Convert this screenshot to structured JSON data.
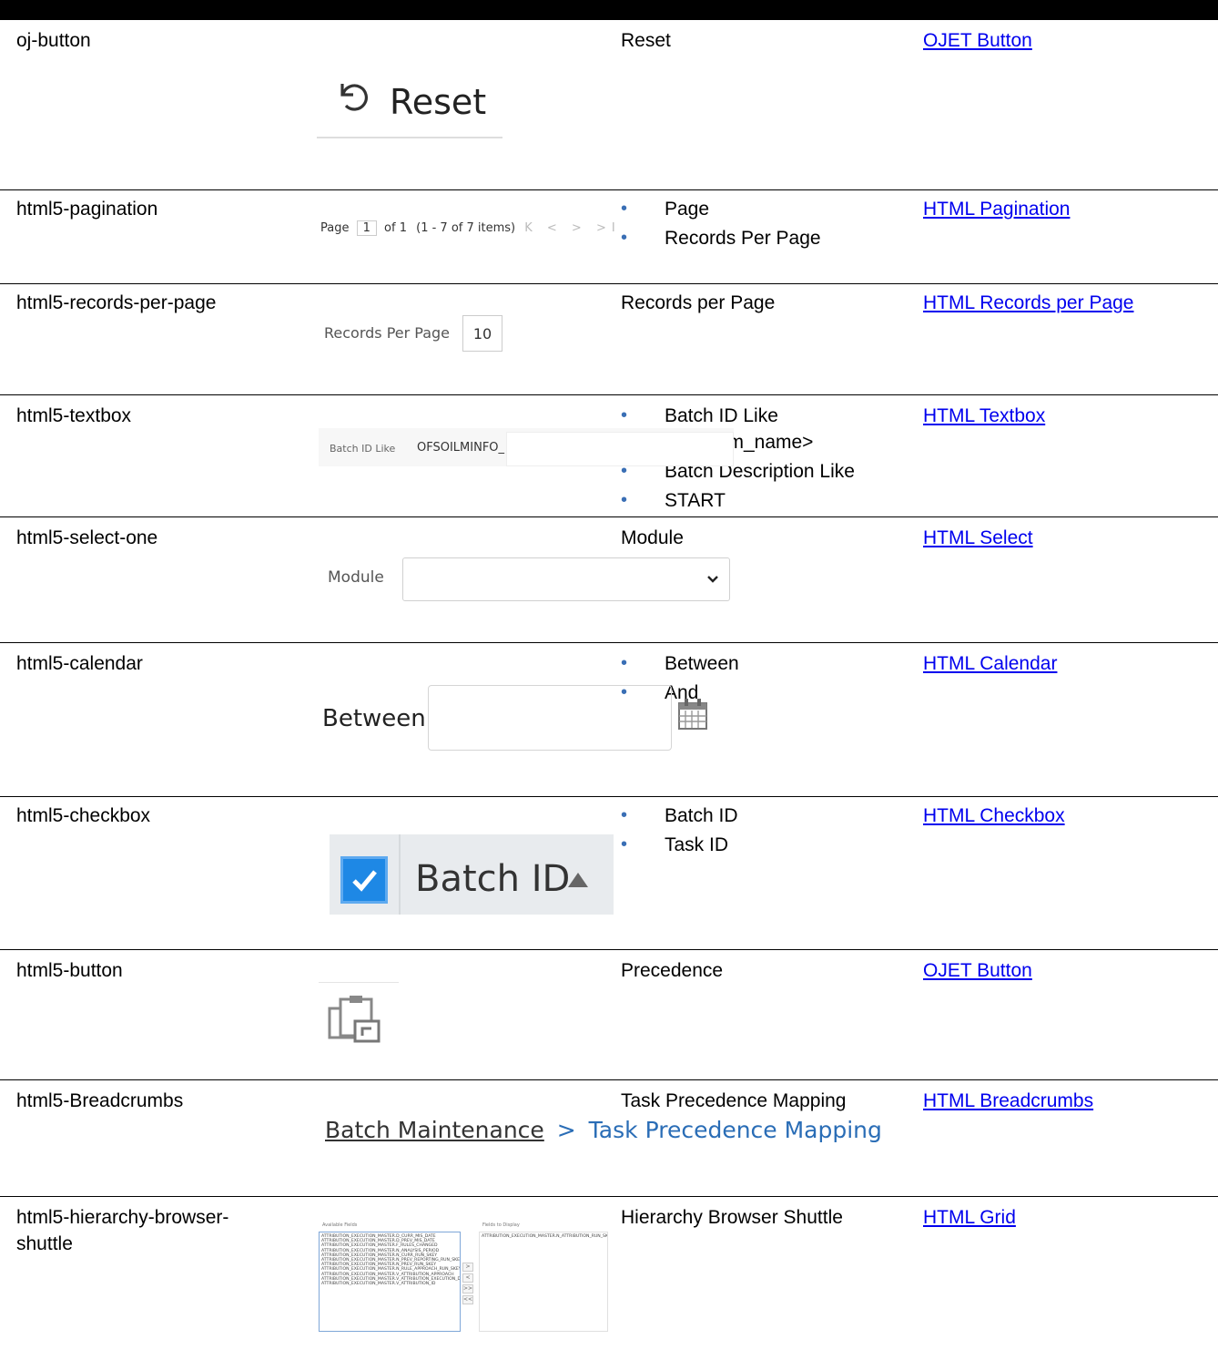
{
  "rows": [
    {
      "name": "oj-button",
      "description": "Reset",
      "link": "OJET Button"
    },
    {
      "name": "html5-pagination",
      "bullets": [
        "Page",
        "Records Per Page"
      ],
      "link": "HTML Pagination"
    },
    {
      "name": "html5-records-per-page",
      "description": "Records per Page",
      "link": "HTML Records per Page"
    },
    {
      "name": "html5-textbox",
      "bullets": [
        "Batch ID Like <infodom_name>",
        "Batch Description Like",
        "START"
      ],
      "link": "HTML Textbox"
    },
    {
      "name": "html5-select-one",
      "description": "Module",
      "link": "HTML Select"
    },
    {
      "name": "html5-calendar",
      "bullets": [
        "Between",
        "And"
      ],
      "link": "HTML Calendar"
    },
    {
      "name": "html5-checkbox",
      "bullets": [
        "Batch ID",
        "Task ID"
      ],
      "link": "HTML Checkbox"
    },
    {
      "name": "html5-button",
      "description": "Precedence",
      "link": "OJET Button"
    },
    {
      "name": "html5-Breadcrumbs",
      "description": "Task Precedence Mapping",
      "link": "HTML Breadcrumbs"
    },
    {
      "name": "html5-hierarchy-browser-shuttle",
      "description": "Hierarchy Browser Shuttle",
      "link": "HTML Grid"
    }
  ],
  "shots": {
    "reset_label": "Reset",
    "pagination": {
      "page_label": "Page",
      "page_value": "1",
      "of_text": "of 1",
      "items_text": "(1 - 7 of  7  items)",
      "nav": "K < > >I"
    },
    "records_per_page": {
      "label": "Records Per Page",
      "value": "10"
    },
    "textbox": {
      "label": "Batch ID Like",
      "value": "OFSOILMINFO_"
    },
    "select": {
      "label": "Module"
    },
    "calendar": {
      "label": "Between"
    },
    "checkbox": {
      "label": "Batch ID"
    },
    "breadcrumb": {
      "parent": "Batch Maintenance",
      "separator": ">",
      "current": "Task Precedence Mapping"
    },
    "shuttle": {
      "available_title": "Available Fields",
      "display_title": "Fields to Display",
      "available": [
        "ATTRIBUTION_EXECUTION_MASTER.D_CURR_MIS_DATE",
        "ATTRIBUTION_EXECUTION_MASTER.D_PREV_MIS_DATE",
        "ATTRIBUTION_EXECUTION_MASTER.F_RULES_CHANGED",
        "ATTRIBUTION_EXECUTION_MASTER.N_ANALYSIS_PERIOD",
        "ATTRIBUTION_EXECUTION_MASTER.N_CURR_RUN_SKEY",
        "ATTRIBUTION_EXECUTION_MASTER.N_PREV_REPORTING_RUN_SKEY",
        "ATTRIBUTION_EXECUTION_MASTER.N_PREV_RUN_SKEY",
        "ATTRIBUTION_EXECUTION_MASTER.N_RULE_APPROACH_RUN_SKEY",
        "ATTRIBUTION_EXECUTION_MASTER.V_ATTRIBUTION_APPROACH",
        "ATTRIBUTION_EXECUTION_MASTER.V_ATTRIBUTION_EXECUTION_DESC",
        "ATTRIBUTION_EXECUTION_MASTER.V_ATTRIBUTION_ID"
      ],
      "display": [
        "ATTRIBUTION_EXECUTION_MASTER.N_ATTRIBUTION_RUN_SKEY"
      ],
      "buttons": [
        ">",
        "<",
        ">>",
        "<<"
      ]
    }
  }
}
